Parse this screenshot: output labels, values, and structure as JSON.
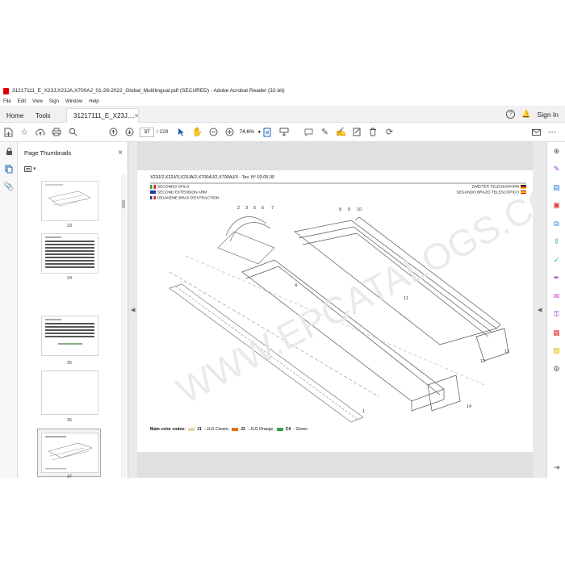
{
  "window": {
    "title": "31217111_E_X23J,X23JA,X700AJ_01-28-2022_Global_Multilingual.pdf (SECURED) - Adobe Acrobat Reader (32-bit)"
  },
  "menu": [
    "File",
    "Edit",
    "View",
    "Sign",
    "Window",
    "Help"
  ],
  "tabs": {
    "home": "Home",
    "tools": "Tools",
    "doc": "31217111_E_X23J,...",
    "doc_close": "×"
  },
  "account": {
    "help": "?",
    "bell": "🔔",
    "signin": "Sign In"
  },
  "toolbar": {
    "current_page": "37",
    "total_pages": "228",
    "zoom": "74,6%"
  },
  "thumbnails": {
    "title": "Page Thumbnails",
    "close": "×",
    "options": "▾",
    "pages": [
      {
        "num": "33"
      },
      {
        "num": "34"
      },
      {
        "num": "35"
      },
      {
        "num": "36"
      },
      {
        "num": "37"
      }
    ]
  },
  "document": {
    "header": "X23J/2,X23J/3,X23JA/2,X700AJ/2,X700AJ/3 - Tav. N° 03.05.00",
    "lang_it": "SECONDO SFILO",
    "lang_en": "SECOND EXTENSION ARM",
    "lang_fr": "DEUXIÈME BRAS D'EXTRACTION",
    "lang_de": "ZWEITER TELESKOPARM",
    "lang_es": "SEGUNDO BRAZO TELESCÓPICO",
    "callouts": [
      "2",
      "3",
      "5",
      "6",
      "7",
      "8",
      "9",
      "10",
      "11",
      "12",
      "13",
      "14",
      "1",
      "4"
    ],
    "legend_label": "Main color codes:",
    "legend": [
      {
        "code": "J1",
        "name": "- JLG Cream,",
        "color": "#e8d3a8"
      },
      {
        "code": "J2",
        "name": "- JLG Orange,",
        "color": "#e0761c"
      },
      {
        "code": "C4",
        "name": "- Green",
        "color": "#2aa34a"
      }
    ],
    "watermark": "WWW.EPCATALOGS.COM"
  }
}
